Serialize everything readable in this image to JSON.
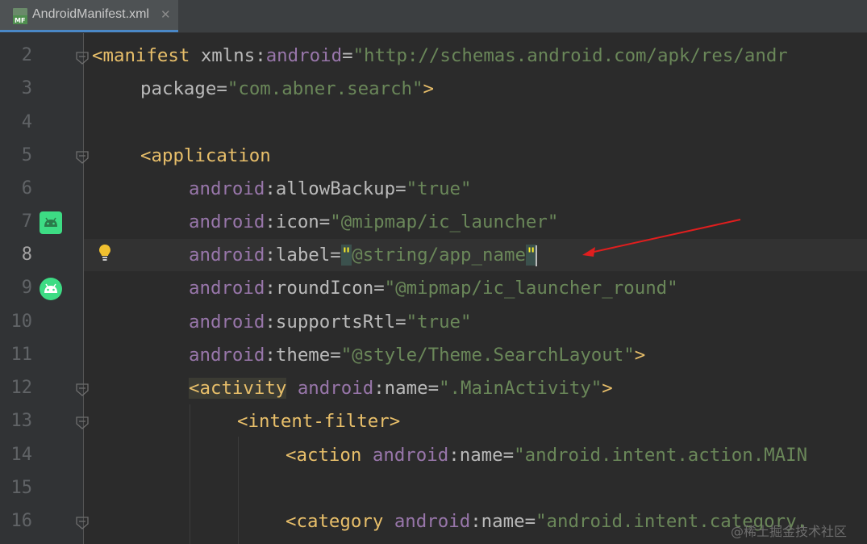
{
  "tab": {
    "label": "AndroidManifest.xml",
    "close": "✕",
    "icon": "manifest-file-icon"
  },
  "gutter": {
    "current_line": 8,
    "line_numbers": [
      "2",
      "3",
      "4",
      "5",
      "6",
      "7",
      "8",
      "9",
      "10",
      "11",
      "12",
      "13",
      "14",
      "15",
      "16"
    ]
  },
  "code": {
    "line2": {
      "open": "<manifest",
      "sp": " ",
      "attr": "xmlns",
      "colon": ":",
      "ns": "android",
      "eq": "=",
      "val": "\"http://schemas.android.com/apk/res/andr"
    },
    "line3": {
      "attr": "package",
      "eq": "=",
      "val": "\"com.abner.search\"",
      "close": ">"
    },
    "line5": {
      "open": "<application"
    },
    "line6": {
      "ns": "android",
      "colon": ":",
      "attr": "allowBackup",
      "eq": "=",
      "val": "\"true\""
    },
    "line7": {
      "ns": "android",
      "colon": ":",
      "attr": "icon",
      "eq": "=",
      "val": "\"@mipmap/ic_launcher\""
    },
    "line8": {
      "ns": "android",
      "colon": ":",
      "attr": "label",
      "eq": "=",
      "q1": "\"",
      "val": "@string/app_name",
      "q2": "\""
    },
    "line9": {
      "ns": "android",
      "colon": ":",
      "attr": "roundIcon",
      "eq": "=",
      "val": "\"@mipmap/ic_launcher_round\""
    },
    "line10": {
      "ns": "android",
      "colon": ":",
      "attr": "supportsRtl",
      "eq": "=",
      "val": "\"true\""
    },
    "line11": {
      "ns": "android",
      "colon": ":",
      "attr": "theme",
      "eq": "=",
      "val": "\"@style/Theme.SearchLayout\"",
      "close": ">"
    },
    "line12": {
      "lt": "<",
      "tag": "activity",
      "sp": " ",
      "ns": "android",
      "colon": ":",
      "attr": "name",
      "eq": "=",
      "val": "\".MainActivity\"",
      "close": ">"
    },
    "line13": {
      "open": "<intent-filter",
      "close": ">"
    },
    "line14": {
      "open": "<action",
      "sp": " ",
      "ns": "android",
      "colon": ":",
      "attr": "name",
      "eq": "=",
      "val": "\"android.intent.action.MAIN"
    },
    "line16": {
      "open": "<category",
      "sp": " ",
      "ns": "android",
      "colon": ":",
      "attr": "name",
      "eq": "=",
      "val": "\"android.intent.category."
    }
  },
  "icons": {
    "line7": "android-app-icon",
    "line9": "android-round-icon",
    "line8": "intention-bulb-icon"
  },
  "annotation": {
    "type": "red-arrow",
    "color": "#e01e1e"
  },
  "watermark": "@稀土掘金技术社区",
  "colors": {
    "background": "#2b2b2b",
    "tag": "#e8bf6a",
    "namespace": "#9876aa",
    "attribute": "#bababa",
    "value": "#6a8759",
    "quote_highlight": "#ffef28",
    "android_green": "#3ddc84"
  }
}
